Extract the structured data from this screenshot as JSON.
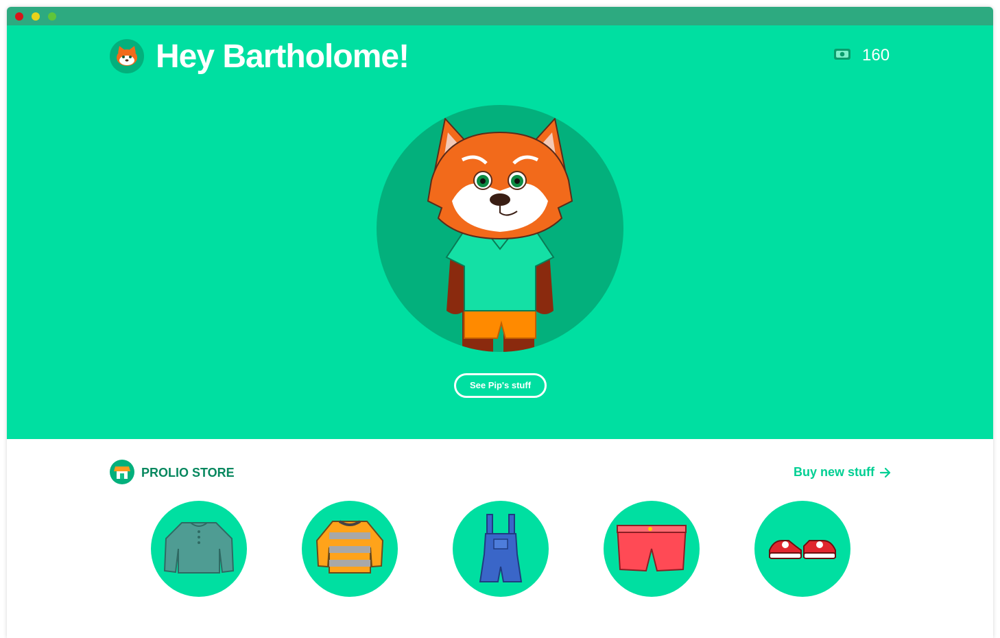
{
  "window": {
    "controls": [
      "close",
      "minimize",
      "maximize"
    ]
  },
  "header": {
    "greeting": "Hey Bartholome!",
    "coins": "160",
    "coin_icon": "money-bill-icon"
  },
  "hero": {
    "character_image": "red-panda-character",
    "see_stuff_label": "See Pip's stuff"
  },
  "store": {
    "title": "PROLIO STORE",
    "title_icon": "shop-icon",
    "buy_label": "Buy new stuff",
    "buy_icon": "arrow-right-icon",
    "items": [
      {
        "name": "teal long-sleeve henley shirt"
      },
      {
        "name": "orange and grey striped sweater"
      },
      {
        "name": "blue denim overalls"
      },
      {
        "name": "red shorts"
      },
      {
        "name": "red and white sneakers"
      }
    ]
  },
  "colors": {
    "brand_green": "#00dfa1",
    "dark_green": "#03b07c",
    "titlebar": "#2daa80",
    "store_title": "#07875e",
    "link": "#00cf93"
  }
}
